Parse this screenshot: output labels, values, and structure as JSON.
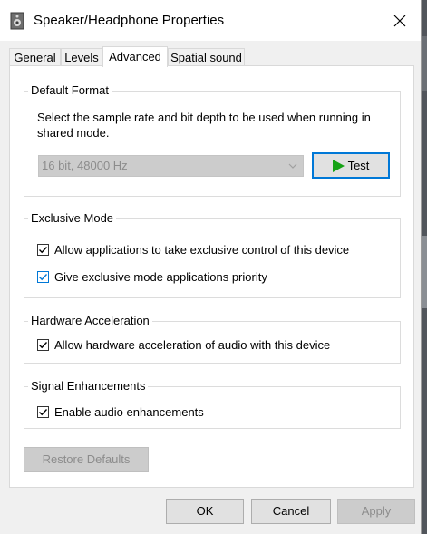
{
  "window": {
    "title": "Speaker/Headphone Properties",
    "close_glyph": "✕"
  },
  "tabs": [
    {
      "label": "General"
    },
    {
      "label": "Levels"
    },
    {
      "label": "Advanced",
      "active": true
    },
    {
      "label": "Spatial sound"
    }
  ],
  "default_format": {
    "label": "Default Format",
    "description": "Select the sample rate and bit depth to be used when running in shared mode.",
    "selected_format": "16 bit, 48000 Hz",
    "test_label": "Test"
  },
  "exclusive_mode": {
    "label": "Exclusive Mode",
    "options": [
      {
        "label": "Allow applications to take exclusive control of this device",
        "checked": true
      },
      {
        "label": "Give exclusive mode applications priority",
        "checked": true
      }
    ]
  },
  "hardware_acceleration": {
    "label": "Hardware Acceleration",
    "option": {
      "label": "Allow hardware acceleration of audio with this device",
      "checked": true
    }
  },
  "signal_enhancements": {
    "label": "Signal Enhancements",
    "option": {
      "label": "Enable audio enhancements",
      "checked": true
    }
  },
  "restore_defaults_label": "Restore Defaults",
  "footer": {
    "ok_label": "OK",
    "cancel_label": "Cancel",
    "apply_label": "Apply"
  },
  "colors": {
    "accent": "#0078d7",
    "play_icon": "#16a316"
  }
}
